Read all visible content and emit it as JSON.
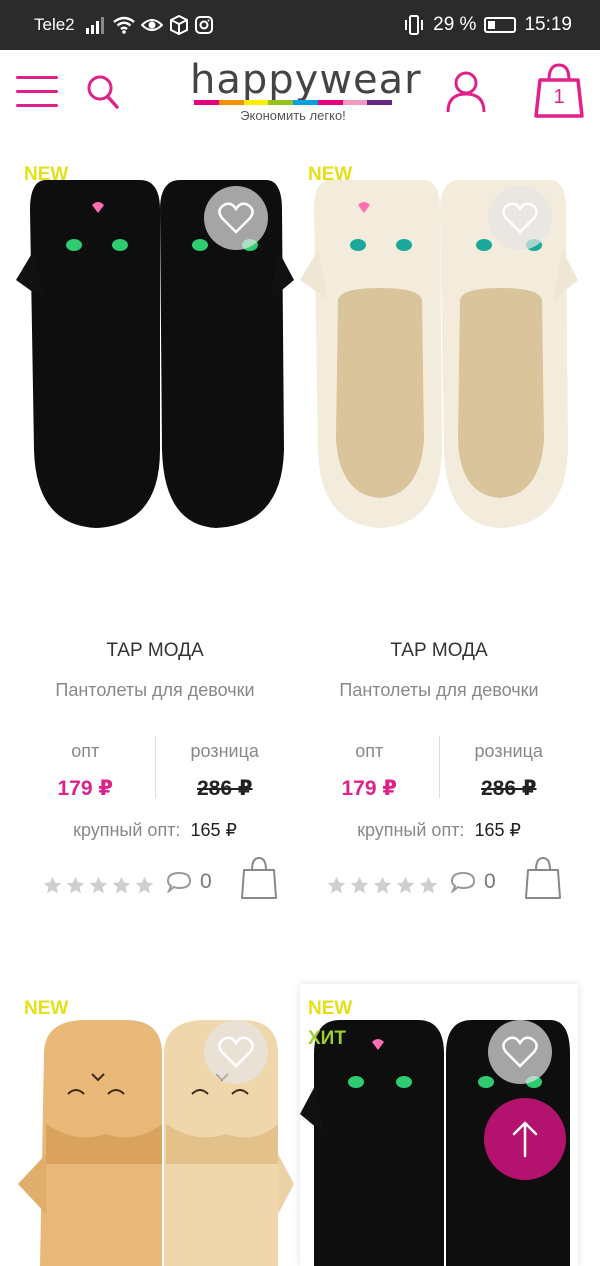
{
  "status_bar": {
    "carrier": "Tele2",
    "battery_percent": "29 %",
    "battery_level": 0.29,
    "time": "15:19"
  },
  "header": {
    "logo_text": "happywear",
    "tagline": "Экономить легко!",
    "cart_count": "1",
    "accent_color": "#e0218a"
  },
  "products": [
    {
      "badges": [
        "NEW"
      ],
      "brand": "ТАР МОДА",
      "name": "Пантолеты для девочки",
      "opt_label": "опт",
      "opt_price": "179 ₽",
      "retail_label": "розница",
      "retail_price": "286 ₽",
      "bulk_label": "крупный опт:",
      "bulk_price": "165 ₽",
      "rating": 0,
      "comments": "0",
      "color": "black"
    },
    {
      "badges": [
        "NEW"
      ],
      "brand": "ТАР МОДА",
      "name": "Пантолеты для девочки",
      "opt_label": "опт",
      "opt_price": "179 ₽",
      "retail_label": "розница",
      "retail_price": "286 ₽",
      "bulk_label": "крупный опт:",
      "bulk_price": "165 ₽",
      "rating": 0,
      "comments": "0",
      "color": "white"
    },
    {
      "badges": [
        "NEW"
      ],
      "color": "beige"
    },
    {
      "badges": [
        "NEW",
        "ХИТ"
      ],
      "color": "black"
    }
  ],
  "badge_colors": {
    "NEW": "#e6e01a",
    "ХИТ": "#9acd32"
  }
}
